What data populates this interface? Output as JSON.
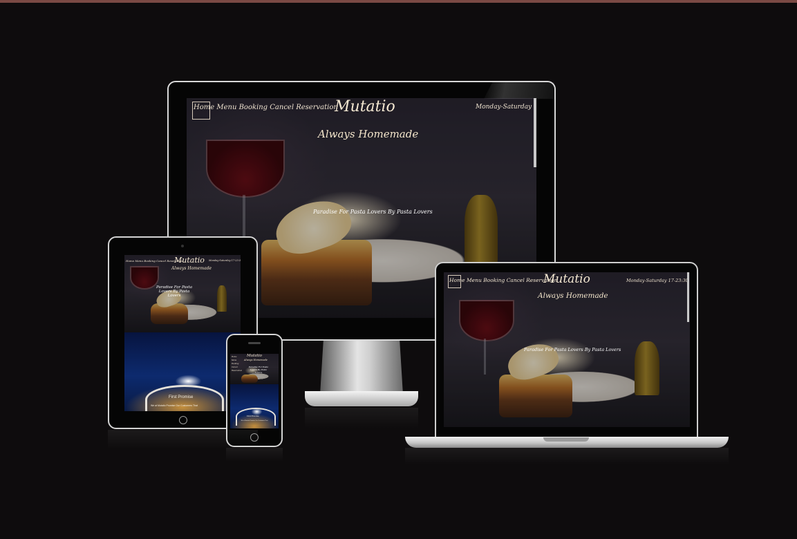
{
  "site": {
    "nav": [
      "Home",
      "Menu",
      "Booking",
      "Cancel Reservation"
    ],
    "brand": "Mutatio",
    "hours": "Monday-Saturday 17-23:30",
    "tagline": "Always Homemade",
    "hero": "Paradise For Pasta Lovers By Pasta Lovers",
    "promise_title": "First Promise",
    "promise_text": "We at Mutatio Promise Our Customers That",
    "home_btn_glyph": "▢"
  }
}
